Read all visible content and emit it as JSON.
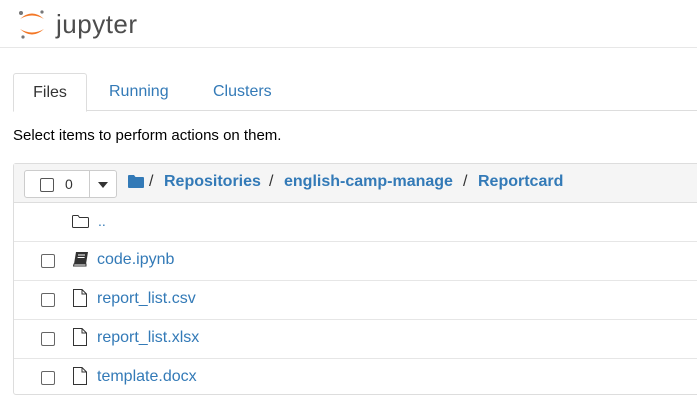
{
  "header": {
    "logo_text": "jupyter"
  },
  "tabs": [
    {
      "label": "Files",
      "active": true
    },
    {
      "label": "Running",
      "active": false
    },
    {
      "label": "Clusters",
      "active": false
    }
  ],
  "instructions": "Select items to perform actions on them.",
  "toolbar": {
    "selected_count": "0"
  },
  "breadcrumb": {
    "separator": "/",
    "items": [
      "Repositories",
      "english-camp-manage",
      "Reportcard"
    ]
  },
  "files": {
    "updir": "..",
    "items": [
      {
        "name": "code.ipynb",
        "icon": "notebook-icon"
      },
      {
        "name": "report_list.csv",
        "icon": "file-icon"
      },
      {
        "name": "report_list.xlsx",
        "icon": "file-icon"
      },
      {
        "name": "template.docx",
        "icon": "file-icon"
      }
    ]
  },
  "colors": {
    "link": "#337ab7",
    "logo_orange": "#f37726"
  }
}
